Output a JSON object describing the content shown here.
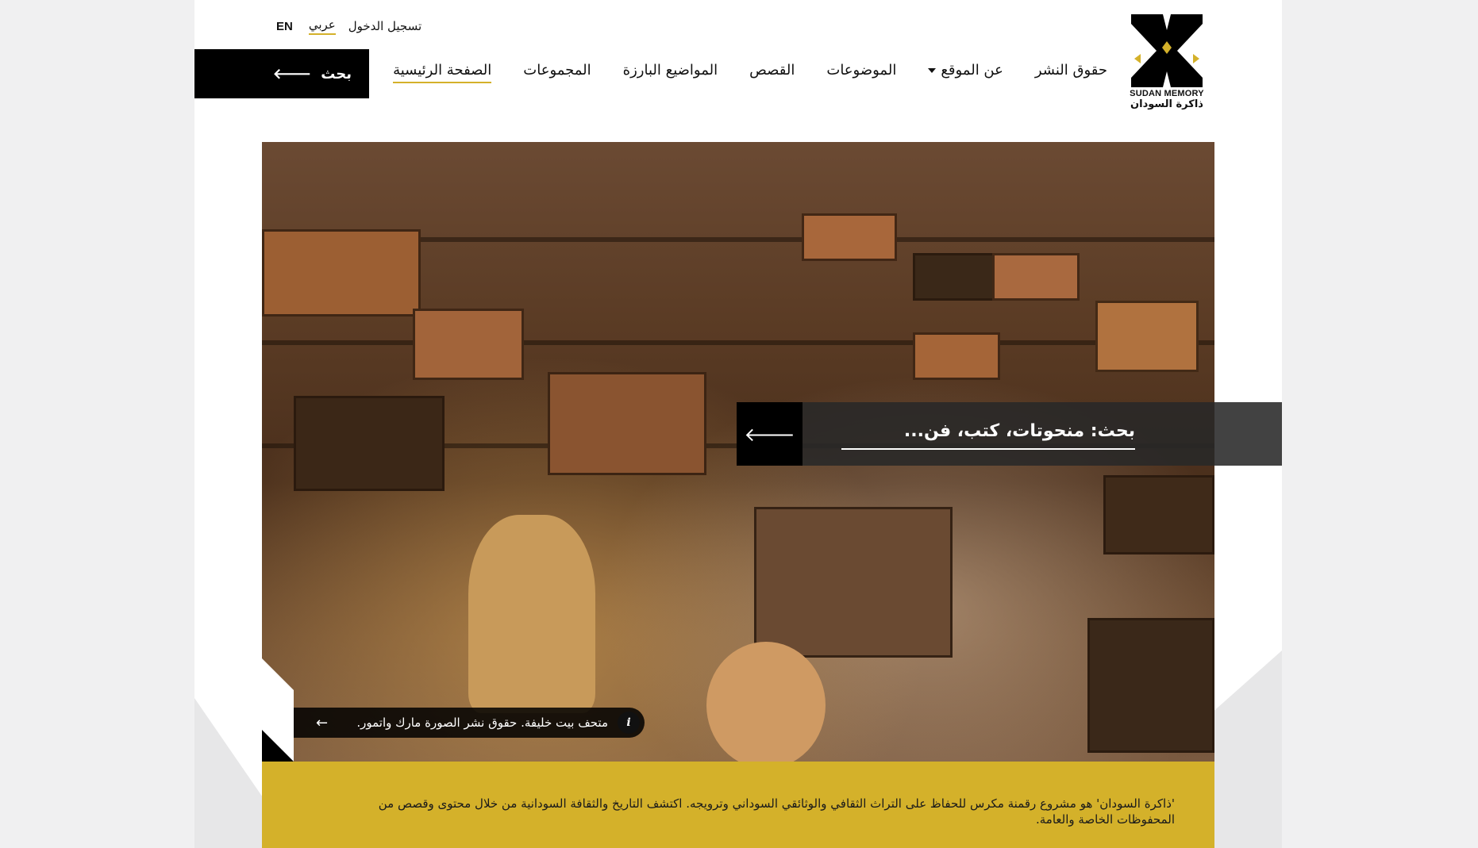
{
  "header": {
    "lang_en": "EN",
    "lang_ar": "عربي",
    "login": "تسجيل الدخول",
    "logo_en": "SUDAN MEMORY",
    "logo_ar": "ذاكرة السودان",
    "search_button": "بحث",
    "nav": [
      {
        "label": "الصفحة الرئيسية",
        "active": true
      },
      {
        "label": "المجموعات"
      },
      {
        "label": "المواضيع البارزة"
      },
      {
        "label": "القصص"
      },
      {
        "label": "الموضوعات"
      },
      {
        "label": "عن الموقع",
        "dropdown": true
      },
      {
        "label": "حقوق النشر"
      }
    ]
  },
  "hero": {
    "search_placeholder": "بحث: منحوتات، كتب، فن...",
    "caption": "متحف بيت خليفة. حقوق نشر الصورة مارك واتمور.",
    "caption_arrow": "←",
    "info_label": "i"
  },
  "intro": {
    "text": "'ذاكرة السودان' هو مشروع رقمنة مكرس للحفاظ على التراث الثقافي والوثائقي السوداني وترويجه. اكتشف التاريخ والثقافة السودانية من خلال محتوى وقصص من المحفوظات الخاصة والعامة."
  },
  "colors": {
    "accent": "#d4b12a",
    "black": "#000000"
  },
  "icons": {
    "search_arrow": "arrow-left-icon",
    "go_arrow": "arrow-left-icon"
  }
}
